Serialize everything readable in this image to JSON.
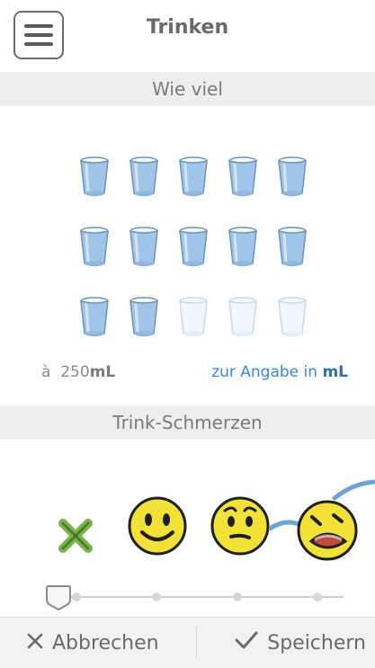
{
  "header": {
    "title": "Trinken"
  },
  "sections": {
    "amount_label": "Wie viel",
    "pain_label": "Trink-Schmerzen"
  },
  "glasses": {
    "total": 15,
    "filled": 12,
    "per_glass_prefix": "à",
    "per_glass_value": "250",
    "unit": "mL",
    "link_text": "zur Angabe in",
    "link_unit": "mL"
  },
  "pain": {
    "options": [
      "none",
      "smile",
      "meh",
      "crying"
    ],
    "selected_index": 0
  },
  "footer": {
    "cancel_label": "Abbrechen",
    "save_label": "Speichern"
  },
  "colors": {
    "glass_full": "#9fc6ea",
    "glass_empty": "#eef5fb",
    "link": "#3a8ad6",
    "emoji": "#f2e238"
  }
}
